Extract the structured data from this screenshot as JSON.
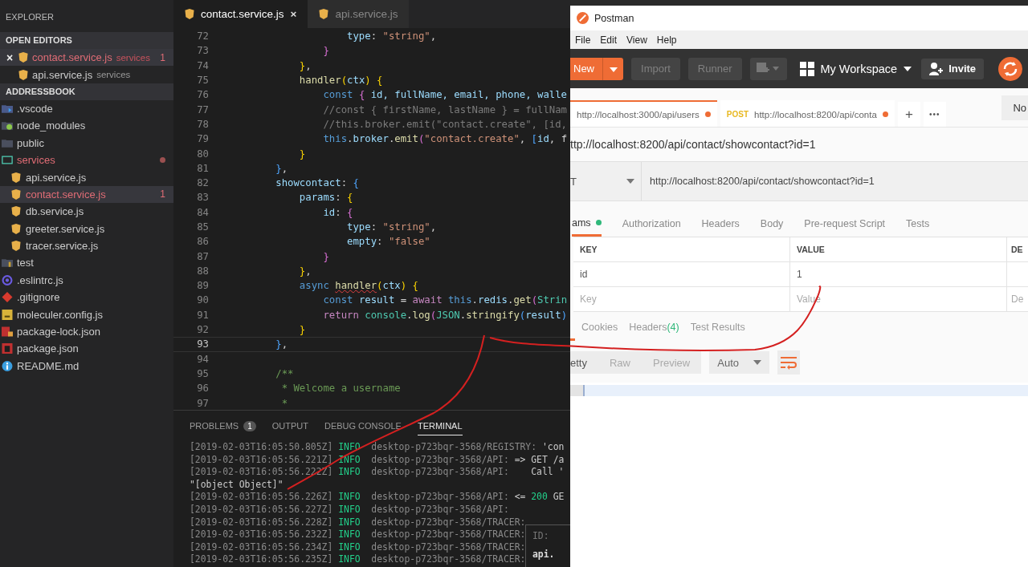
{
  "vscode": {
    "sidebar": {
      "title": "EXPLORER",
      "open_editors": {
        "title": "OPEN EDITORS",
        "items": [
          {
            "name": "contact.service.js",
            "detail": "services",
            "badge": "1",
            "modified": true,
            "close": "×",
            "kind": "angular"
          },
          {
            "name": "api.service.js",
            "detail": "services",
            "modified": false,
            "kind": "angular"
          }
        ]
      },
      "project": {
        "title": "ADDRESSBOOK",
        "items": [
          {
            "name": ".vscode",
            "kind": "folder-vscode",
            "modified": false,
            "selected": false
          },
          {
            "name": "node_modules",
            "kind": "folder-node",
            "modified": false,
            "selected": false
          },
          {
            "name": "public",
            "kind": "folder",
            "modified": false,
            "selected": false
          },
          {
            "name": "services",
            "kind": "folder-open",
            "modified": true,
            "dot": true,
            "selected": false,
            "expanded": true,
            "children": [
              {
                "name": "api.service.js",
                "kind": "angular",
                "modified": false,
                "selected": false
              },
              {
                "name": "contact.service.js",
                "kind": "angular",
                "modified": true,
                "badge": "1",
                "selected": true
              },
              {
                "name": "db.service.js",
                "kind": "angular",
                "modified": false,
                "selected": false
              },
              {
                "name": "greeter.service.js",
                "kind": "angular",
                "modified": false,
                "selected": false
              },
              {
                "name": "tracer.service.js",
                "kind": "angular",
                "modified": false,
                "selected": false
              }
            ]
          },
          {
            "name": "test",
            "kind": "folder-test",
            "modified": false,
            "selected": false
          },
          {
            "name": ".eslintrc.js",
            "kind": "eslint",
            "modified": false,
            "selected": false
          },
          {
            "name": ".gitignore",
            "kind": "git",
            "modified": false,
            "selected": false
          },
          {
            "name": "moleculer.config.js",
            "kind": "js",
            "modified": false,
            "selected": false
          },
          {
            "name": "package-lock.json",
            "kind": "npm-lock",
            "modified": false,
            "selected": false
          },
          {
            "name": "package.json",
            "kind": "npm",
            "modified": false,
            "selected": false
          },
          {
            "name": "README.md",
            "kind": "info",
            "modified": false,
            "selected": false
          }
        ]
      }
    },
    "editor_tabs": [
      {
        "label": "contact.service.js",
        "selected": true,
        "close": "×"
      },
      {
        "label": "api.service.js",
        "selected": false
      }
    ],
    "code_lines": [
      {
        "number": "72",
        "current": false,
        "tokens": [
          {
            "kind": "prop",
            "t": "                    type"
          },
          {
            "kind": "plain",
            "t": ": "
          },
          {
            "kind": "str",
            "t": "\"string\""
          },
          {
            "kind": "plain",
            "t": ","
          }
        ]
      },
      {
        "number": "73",
        "current": false,
        "tokens": [
          {
            "kind": "b2",
            "t": "                }"
          }
        ]
      },
      {
        "number": "74",
        "current": false,
        "tokens": [
          {
            "kind": "b1",
            "t": "            }"
          },
          {
            "kind": "plain",
            "t": ","
          }
        ]
      },
      {
        "number": "75",
        "current": false,
        "tokens": [
          {
            "kind": "fn",
            "t": "            handler"
          },
          {
            "kind": "b1",
            "t": "("
          },
          {
            "kind": "prop",
            "t": "ctx"
          },
          {
            "kind": "b1",
            "t": ") {"
          }
        ]
      },
      {
        "number": "76",
        "current": false,
        "tokens": [
          {
            "kind": "kw",
            "t": "                const"
          },
          {
            "kind": "b2",
            "t": " {"
          },
          {
            "kind": "prop",
            "t": " id, fullName, email, phone, walle"
          }
        ]
      },
      {
        "number": "77",
        "current": false,
        "tokens": [
          {
            "kind": "dim",
            "t": "                //const { firstName, lastName } = fullNam"
          }
        ]
      },
      {
        "number": "78",
        "current": false,
        "tokens": [
          {
            "kind": "dim",
            "t": "                //this.broker.emit(\"contact.create\", [id,"
          }
        ]
      },
      {
        "number": "79",
        "current": false,
        "tokens": [
          {
            "kind": "kw",
            "t": "                this"
          },
          {
            "kind": "plain",
            "t": "."
          },
          {
            "kind": "prop",
            "t": "broker"
          },
          {
            "kind": "plain",
            "t": "."
          },
          {
            "kind": "fn",
            "t": "emit"
          },
          {
            "kind": "b2",
            "t": "("
          },
          {
            "kind": "str",
            "t": "\"contact.create\""
          },
          {
            "kind": "plain",
            "t": ","
          },
          {
            "kind": "b3",
            "t": " ["
          },
          {
            "kind": "prop",
            "t": "id"
          },
          {
            "kind": "plain",
            "t": ", f"
          }
        ]
      },
      {
        "number": "80",
        "current": false,
        "tokens": [
          {
            "kind": "b1",
            "t": "            }"
          }
        ]
      },
      {
        "number": "81",
        "current": false,
        "tokens": [
          {
            "kind": "b3",
            "t": "        }"
          },
          {
            "kind": "plain",
            "t": ","
          }
        ]
      },
      {
        "number": "82",
        "current": false,
        "tokens": [
          {
            "kind": "prop",
            "t": "        showcontact"
          },
          {
            "kind": "plain",
            "t": ":"
          },
          {
            "kind": "b3",
            "t": " {"
          }
        ]
      },
      {
        "number": "83",
        "current": false,
        "tokens": [
          {
            "kind": "prop",
            "t": "            params"
          },
          {
            "kind": "plain",
            "t": ":"
          },
          {
            "kind": "b1",
            "t": " {"
          }
        ]
      },
      {
        "number": "84",
        "current": false,
        "tokens": [
          {
            "kind": "prop",
            "t": "                id"
          },
          {
            "kind": "plain",
            "t": ":"
          },
          {
            "kind": "b2",
            "t": " {"
          }
        ]
      },
      {
        "number": "85",
        "current": false,
        "tokens": [
          {
            "kind": "prop",
            "t": "                    type"
          },
          {
            "kind": "plain",
            "t": ": "
          },
          {
            "kind": "str",
            "t": "\"string\""
          },
          {
            "kind": "plain",
            "t": ","
          }
        ]
      },
      {
        "number": "86",
        "current": false,
        "tokens": [
          {
            "kind": "prop",
            "t": "                    empty"
          },
          {
            "kind": "plain",
            "t": ": "
          },
          {
            "kind": "str",
            "t": "\"false\""
          }
        ]
      },
      {
        "number": "87",
        "current": false,
        "tokens": [
          {
            "kind": "b2",
            "t": "                }"
          }
        ]
      },
      {
        "number": "88",
        "current": false,
        "tokens": [
          {
            "kind": "b1",
            "t": "            }"
          },
          {
            "kind": "plain",
            "t": ","
          }
        ]
      },
      {
        "number": "89",
        "current": false,
        "tokens": [
          {
            "kind": "kw",
            "t": "            async "
          },
          {
            "kind": "warn",
            "t": "handler"
          },
          {
            "kind": "b1",
            "t": "("
          },
          {
            "kind": "prop",
            "t": "ctx"
          },
          {
            "kind": "b1",
            "t": ") {"
          }
        ]
      },
      {
        "number": "90",
        "current": false,
        "tokens": [
          {
            "kind": "kw",
            "t": "                const"
          },
          {
            "kind": "prop",
            "t": " result"
          },
          {
            "kind": "plain",
            "t": " = "
          },
          {
            "kind": "ctl",
            "t": "await"
          },
          {
            "kind": "kw",
            "t": " this"
          },
          {
            "kind": "plain",
            "t": "."
          },
          {
            "kind": "prop",
            "t": "redis"
          },
          {
            "kind": "plain",
            "t": "."
          },
          {
            "kind": "fn",
            "t": "get"
          },
          {
            "kind": "b2",
            "t": "("
          },
          {
            "kind": "cls",
            "t": "Strin"
          }
        ]
      },
      {
        "number": "91",
        "current": false,
        "tokens": [
          {
            "kind": "ctl",
            "t": "                return"
          },
          {
            "kind": "cls",
            "t": " console"
          },
          {
            "kind": "plain",
            "t": "."
          },
          {
            "kind": "fn",
            "t": "log"
          },
          {
            "kind": "b2",
            "t": "("
          },
          {
            "kind": "cls",
            "t": "JSON"
          },
          {
            "kind": "plain",
            "t": "."
          },
          {
            "kind": "fn",
            "t": "stringify"
          },
          {
            "kind": "b3",
            "t": "("
          },
          {
            "kind": "prop",
            "t": "result"
          },
          {
            "kind": "b3",
            "t": ")"
          }
        ]
      },
      {
        "number": "92",
        "current": false,
        "tokens": [
          {
            "kind": "b1",
            "t": "            }"
          }
        ]
      },
      {
        "number": "93",
        "current": true,
        "tokens": [
          {
            "kind": "b3",
            "t": "        }"
          },
          {
            "kind": "plain",
            "t": ","
          }
        ]
      },
      {
        "number": "94",
        "current": false
      },
      {
        "number": "95",
        "current": false,
        "tokens": [
          {
            "kind": "cmt",
            "t": "        /**"
          }
        ]
      },
      {
        "number": "96",
        "current": false,
        "tokens": [
          {
            "kind": "cmt",
            "t": "         * Welcome a username"
          }
        ]
      },
      {
        "number": "97",
        "current": false,
        "tokens": [
          {
            "kind": "cmt",
            "t": "         *"
          }
        ]
      }
    ],
    "panel_tabs": [
      {
        "label": "PROBLEMS",
        "badge": "1",
        "selected": false
      },
      {
        "label": "OUTPUT",
        "selected": false
      },
      {
        "label": "DEBUG CONSOLE",
        "selected": false
      },
      {
        "label": "TERMINAL",
        "selected": true
      }
    ],
    "terminal_lines": [
      [
        {
          "kind": "ts",
          "t": "[2019-02-03T16:05:50.805Z]"
        },
        {
          "kind": "info",
          "t": " INFO"
        },
        {
          "kind": "host",
          "t": "  desktop-p723bqr-3568/REGISTRY:"
        },
        {
          "kind": "out",
          "t": " 'con"
        }
      ],
      [
        {
          "kind": "ts",
          "t": "[2019-02-03T16:05:56.221Z]"
        },
        {
          "kind": "info",
          "t": " INFO"
        },
        {
          "kind": "host",
          "t": "  desktop-p723bqr-3568/API:"
        },
        {
          "kind": "out",
          "t": " => GET /a"
        }
      ],
      [
        {
          "kind": "ts",
          "t": "[2019-02-03T16:05:56.222Z]"
        },
        {
          "kind": "info",
          "t": " INFO"
        },
        {
          "kind": "host",
          "t": "  desktop-p723bqr-3568/API:"
        },
        {
          "kind": "out",
          "t": "    Call '"
        }
      ],
      [
        {
          "kind": "out",
          "t": "\"[object Object]\""
        }
      ],
      [
        {
          "kind": "ts",
          "t": "[2019-02-03T16:05:56.226Z]"
        },
        {
          "kind": "info",
          "t": " INFO"
        },
        {
          "kind": "host",
          "t": "  desktop-p723bqr-3568/API:"
        },
        {
          "kind": "out",
          "t": " <="
        },
        {
          "kind": "num",
          "t": " 200"
        },
        {
          "kind": "out",
          "t": " GE"
        }
      ],
      [
        {
          "kind": "ts",
          "t": "[2019-02-03T16:05:56.227Z]"
        },
        {
          "kind": "info",
          "t": " INFO"
        },
        {
          "kind": "host",
          "t": "  desktop-p723bqr-3568/API:"
        }
      ],
      [
        {
          "kind": "ts",
          "t": "[2019-02-03T16:05:56.228Z]"
        },
        {
          "kind": "info",
          "t": " INFO"
        },
        {
          "kind": "host",
          "t": "  desktop-p723bqr-3568/TRACER:"
        }
      ],
      [
        {
          "kind": "ts",
          "t": "[2019-02-03T16:05:56.232Z]"
        },
        {
          "kind": "info",
          "t": " INFO"
        },
        {
          "kind": "host",
          "t": "  desktop-p723bqr-3568/TRACER:"
        }
      ],
      [
        {
          "kind": "ts",
          "t": "[2019-02-03T16:05:56.234Z]"
        },
        {
          "kind": "info",
          "t": " INFO"
        },
        {
          "kind": "host",
          "t": "  desktop-p723bqr-3568/TRACER:"
        }
      ],
      [
        {
          "kind": "ts",
          "t": "[2019-02-03T16:05:56.235Z]"
        },
        {
          "kind": "info",
          "t": " INFO"
        },
        {
          "kind": "host",
          "t": "  desktop-p723bqr-3568/TRACER:"
        }
      ]
    ],
    "terminal_table": [
      "ID:",
      "api."
    ]
  },
  "postman": {
    "title": "Postman",
    "menu": [
      "File",
      "Edit",
      "View",
      "Help"
    ],
    "toolbar": {
      "new": "New",
      "import": "Import",
      "runner": "Runner",
      "workspace": "My Workspace",
      "invite": "Invite"
    },
    "request_tabs": [
      {
        "url": "http://localhost:3000/api/users",
        "selected": true,
        "unsaved": true
      },
      {
        "method": "POST",
        "url": "http://localhost:8200/api/conta",
        "selected": false,
        "unsaved": true
      }
    ],
    "add_tab": "+",
    "more_tabs": "•••",
    "environment": "No",
    "request_name": "ttp://localhost:8200/api/contact/showcontact?id=1",
    "method": "T",
    "url": "http://localhost:8200/api/contact/showcontact?id=1",
    "request_tabs_params": [
      {
        "label": "ams",
        "selected": true,
        "dot": true
      },
      {
        "label": "Authorization",
        "selected": false
      },
      {
        "label": "Headers",
        "selected": false
      },
      {
        "label": "Body",
        "selected": false
      },
      {
        "label": "Pre-request Script",
        "selected": false
      },
      {
        "label": "Tests",
        "selected": false
      }
    ],
    "params_table": {
      "columns": [
        "KEY",
        "VALUE",
        "DE"
      ],
      "rows": [
        {
          "key": "id",
          "value": "1"
        }
      ],
      "new_row": [
        {
          "placeholder": "Key"
        },
        {
          "placeholder": "Value"
        },
        {
          "placeholder": "De"
        }
      ]
    },
    "response_tabs": [
      {
        "label": "Cookies",
        "selected": false
      },
      {
        "label": "Headers",
        "count": "(4)",
        "selected": false
      },
      {
        "label": "Test Results",
        "selected": false
      }
    ],
    "response_view": [
      {
        "label": "etty",
        "selected": true
      },
      {
        "label": "Raw",
        "selected": false
      },
      {
        "label": "Preview",
        "selected": false
      }
    ],
    "format": "Auto"
  },
  "annotation": true
}
